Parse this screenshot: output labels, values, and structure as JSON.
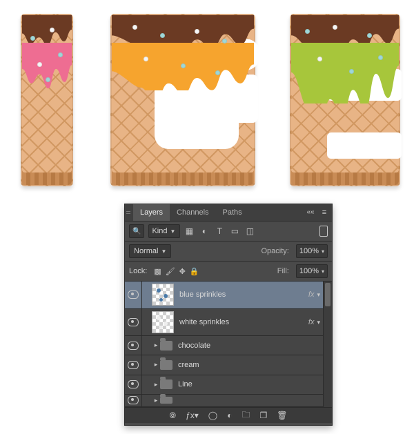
{
  "artwork": {
    "word": "ICE",
    "letters": [
      {
        "char": "I",
        "topping_colors": [
          "#6b3a23",
          "#ee6d92"
        ]
      },
      {
        "char": "C",
        "topping_colors": [
          "#6b3a23",
          "#f6a42e"
        ],
        "has_bite": true
      },
      {
        "char": "E",
        "topping_colors": [
          "#6b3a23",
          "#a7c63b"
        ]
      }
    ],
    "sprinkle_colors": {
      "white": "#f6f6f6",
      "blue": "#9fd7d7"
    }
  },
  "panel": {
    "tabs": [
      {
        "id": "layers",
        "label": "Layers",
        "active": true
      },
      {
        "id": "channels",
        "label": "Channels",
        "active": false
      },
      {
        "id": "paths",
        "label": "Paths",
        "active": false
      }
    ],
    "filter": {
      "kind_label": "Kind"
    },
    "blend": {
      "mode": "Normal",
      "opacity_label": "Opacity:",
      "opacity_value": "100%"
    },
    "lock": {
      "label": "Lock:",
      "fill_label": "Fill:",
      "fill_value": "100%"
    },
    "layers": [
      {
        "type": "layer",
        "name": "blue sprinkles",
        "selected": true,
        "has_fx": true,
        "thumb": "blue"
      },
      {
        "type": "layer",
        "name": "white sprinkles",
        "selected": false,
        "has_fx": true,
        "thumb": "white"
      },
      {
        "type": "group",
        "name": "chocolate"
      },
      {
        "type": "group",
        "name": "cream"
      },
      {
        "type": "group",
        "name": "Line"
      },
      {
        "type": "group",
        "name": ""
      }
    ],
    "fx_label": "fx",
    "footer_icons": [
      "link",
      "fx",
      "mask",
      "adjust",
      "group",
      "new",
      "trash"
    ]
  }
}
